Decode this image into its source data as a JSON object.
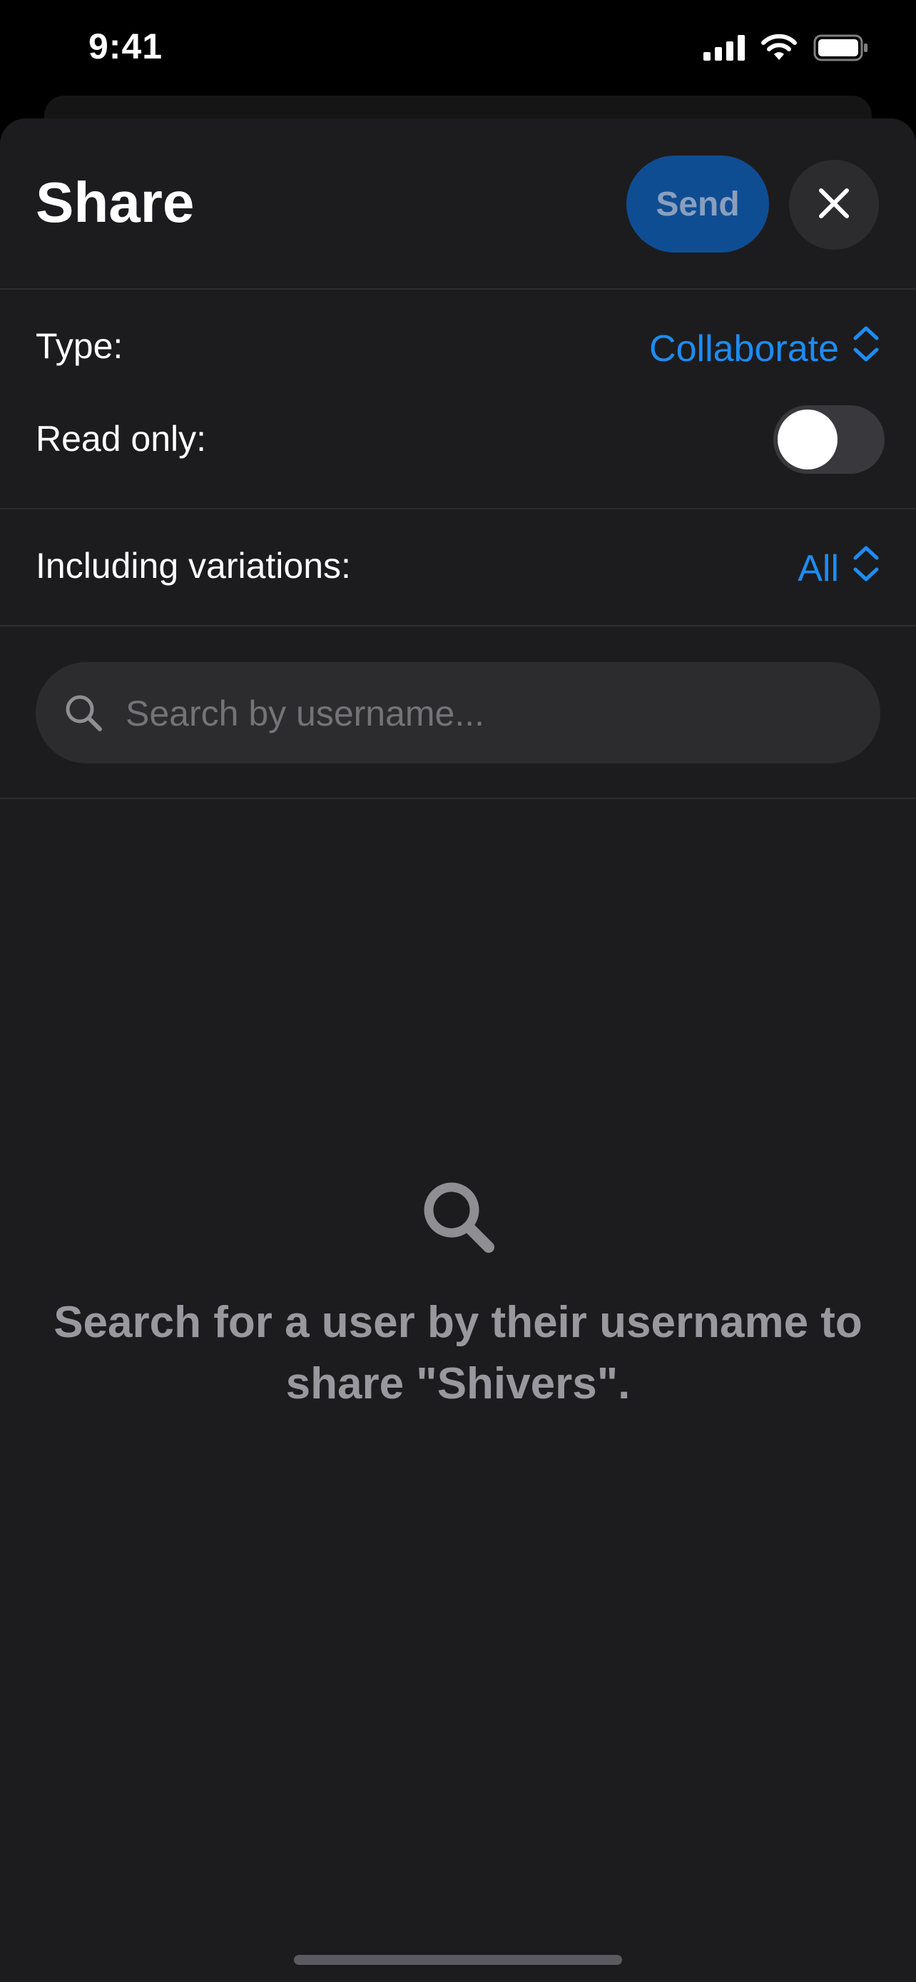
{
  "status_bar": {
    "time": "9:41",
    "icons": [
      "cellular-signal-icon",
      "wifi-icon",
      "battery-icon"
    ]
  },
  "sheet": {
    "title": "Share",
    "send_label": "Send",
    "close_icon": "close-icon"
  },
  "settings": {
    "type_label": "Type:",
    "type_value": "Collaborate",
    "read_only_label": "Read only:",
    "read_only_on": false,
    "variations_label": "Including variations:",
    "variations_value": "All"
  },
  "search": {
    "placeholder": "Search by username...",
    "value": ""
  },
  "empty_state": {
    "icon": "search-icon",
    "message": "Search for a user by their username to share \"Shivers\"."
  },
  "colors": {
    "accent": "#1e8cf5",
    "send_button_bg": "#0f4d93",
    "sheet_bg": "#1c1c1e",
    "field_bg": "#2c2c2e",
    "secondary_text": "#98989e"
  }
}
